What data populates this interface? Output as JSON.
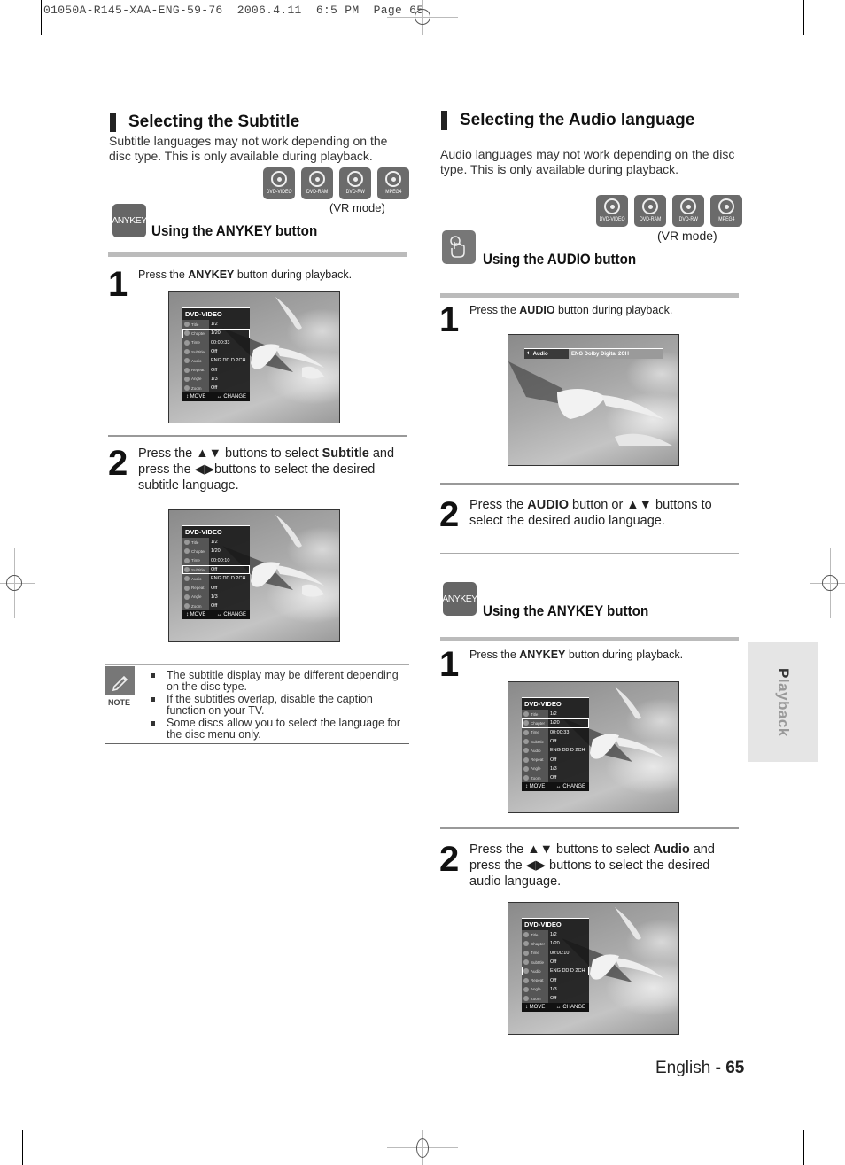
{
  "print_header": "01050A-R145-XAA-ENG-59-76  2006.4.11  6:5 PM  Page 65",
  "left": {
    "title": "Selecting the Subtitle",
    "intro": "Subtitle languages may not work depending on the disc type. This is only available during playback.",
    "disc_types": [
      "DVD-VIDEO",
      "DVD-RAM",
      "DVD-RW",
      "MPEG4"
    ],
    "vr_mode": "(VR mode)",
    "method_icon_label": "ANYKEY",
    "method_title": "Using the ANYKEY button",
    "step1": {
      "num": "1",
      "pre": "Press the ",
      "bold": "ANYKEY",
      "post": " button during playback."
    },
    "step2": {
      "num": "2",
      "pre": "Press the ▲▼  buttons to select ",
      "bold": "Subtitle",
      "post": " and press the ◀▶buttons to select the desired subtitle language."
    },
    "osd1": {
      "header": "DVD-VIDEO",
      "rows": [
        {
          "label": "Title",
          "value": "1/2",
          "selected": false
        },
        {
          "label": "Chapter",
          "value": "1/20",
          "selected": true
        },
        {
          "label": "Time",
          "value": "00:00:33",
          "selected": false
        },
        {
          "label": "Subtitle",
          "value": "Off",
          "selected": false
        },
        {
          "label": "Audio",
          "value": "ENG DD D  2CH",
          "selected": false
        },
        {
          "label": "Repeat",
          "value": "Off",
          "selected": false
        },
        {
          "label": "Angle",
          "value": "1/3",
          "selected": false
        },
        {
          "label": "Zoom",
          "value": "Off",
          "selected": false
        }
      ],
      "footer_move": "↕ MOVE",
      "footer_change": "↔ CHANGE"
    },
    "osd2": {
      "header": "DVD-VIDEO",
      "rows": [
        {
          "label": "Title",
          "value": "1/2",
          "selected": false
        },
        {
          "label": "Chapter",
          "value": "1/20",
          "selected": false
        },
        {
          "label": "Time",
          "value": "00:00:10",
          "selected": false
        },
        {
          "label": "Subtitle",
          "value": "Off",
          "selected": true
        },
        {
          "label": "Audio",
          "value": "ENG DD D  2CH",
          "selected": false
        },
        {
          "label": "Repeat",
          "value": "Off",
          "selected": false
        },
        {
          "label": "Angle",
          "value": "1/3",
          "selected": false
        },
        {
          "label": "Zoom",
          "value": "Off",
          "selected": false
        }
      ],
      "footer_move": "↕ MOVE",
      "footer_change": "↔ CHANGE"
    },
    "note": {
      "label": "NOTE",
      "items": [
        "The subtitle display may be different depending on the disc type.",
        "If the subtitles overlap, disable the caption function on your TV.",
        "Some discs allow you to select the language for the disc menu only."
      ]
    }
  },
  "right": {
    "title": "Selecting the Audio language",
    "intro": "Audio languages may not work depending on the disc type. This is only available during playback.",
    "disc_types": [
      "DVD-VIDEO",
      "DVD-RAM",
      "DVD-RW",
      "MPEG4"
    ],
    "vr_mode": "(VR mode)",
    "audio_method_title": "Using the AUDIO button",
    "audio_step1": {
      "num": "1",
      "pre": "Press the ",
      "bold": "AUDIO",
      "post": " button during playback."
    },
    "audio_bar": {
      "label": "Audio",
      "value": "ENG Dolby Digital 2CH"
    },
    "audio_step2": {
      "num": "2",
      "pre": "Press the ",
      "bold": "AUDIO",
      "post": " button or ▲▼ buttons to select the desired audio language."
    },
    "anykey_icon_label": "ANYKEY",
    "anykey_method_title": "Using the ANYKEY button",
    "anykey_step1": {
      "num": "1",
      "pre": "Press the ",
      "bold": "ANYKEY",
      "post": " button during playback."
    },
    "anykey_step2": {
      "num": "2",
      "pre": "Press the ▲▼ buttons to select ",
      "bold": "Audio",
      "post": " and press the ◀▶ buttons to select the desired audio language."
    },
    "osd1": {
      "header": "DVD-VIDEO",
      "rows": [
        {
          "label": "Title",
          "value": "1/2",
          "selected": false
        },
        {
          "label": "Chapter",
          "value": "1/20",
          "selected": true
        },
        {
          "label": "Time",
          "value": "00:00:33",
          "selected": false
        },
        {
          "label": "Subtitle",
          "value": "Off",
          "selected": false
        },
        {
          "label": "Audio",
          "value": "ENG DD D  2CH",
          "selected": false
        },
        {
          "label": "Repeat",
          "value": "Off",
          "selected": false
        },
        {
          "label": "Angle",
          "value": "1/3",
          "selected": false
        },
        {
          "label": "Zoom",
          "value": "Off",
          "selected": false
        }
      ],
      "footer_move": "↕ MOVE",
      "footer_change": "↔ CHANGE"
    },
    "osd2": {
      "header": "DVD-VIDEO",
      "rows": [
        {
          "label": "Title",
          "value": "1/2",
          "selected": false
        },
        {
          "label": "Chapter",
          "value": "1/20",
          "selected": false
        },
        {
          "label": "Time",
          "value": "00:00:10",
          "selected": false
        },
        {
          "label": "Subtitle",
          "value": "Off",
          "selected": false
        },
        {
          "label": "Audio",
          "value": "ENG DD D  2CH",
          "selected": true
        },
        {
          "label": "Repeat",
          "value": "Off",
          "selected": false
        },
        {
          "label": "Angle",
          "value": "1/3",
          "selected": false
        },
        {
          "label": "Zoom",
          "value": "Off",
          "selected": false
        }
      ],
      "footer_move": "↕ MOVE",
      "footer_change": "↔ CHANGE"
    }
  },
  "side_tab": "Playback",
  "footer": {
    "lang": "English",
    "sep": " - ",
    "page": "65"
  }
}
